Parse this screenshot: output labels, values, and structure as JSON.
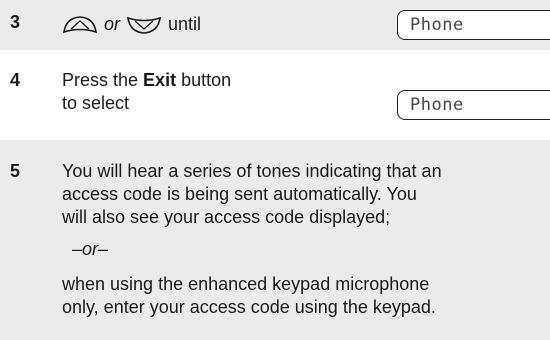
{
  "steps": [
    {
      "number": "3",
      "text_mid_or": "or",
      "text_end": "until",
      "display": "Phone",
      "icons": [
        "up-arrow-key-icon",
        "down-arrow-key-icon"
      ]
    },
    {
      "number": "4",
      "line1_pre": "Press the ",
      "line1_bold": "Exit",
      "line1_post": " button",
      "line2": "to select",
      "display": "Phone"
    },
    {
      "number": "5",
      "lines": [
        "You will hear a series of tones indicating that an",
        "access code is being sent automatically. You",
        "will also see your access code displayed;"
      ],
      "or_divider": "–or–",
      "lines_after": [
        "when using the enhanced keypad microphone",
        "only, enter your access code using the keypad."
      ]
    }
  ],
  "colors": {
    "band": "#ebebeb",
    "text": "#1a1a1a",
    "lcd_text": "#444444"
  }
}
